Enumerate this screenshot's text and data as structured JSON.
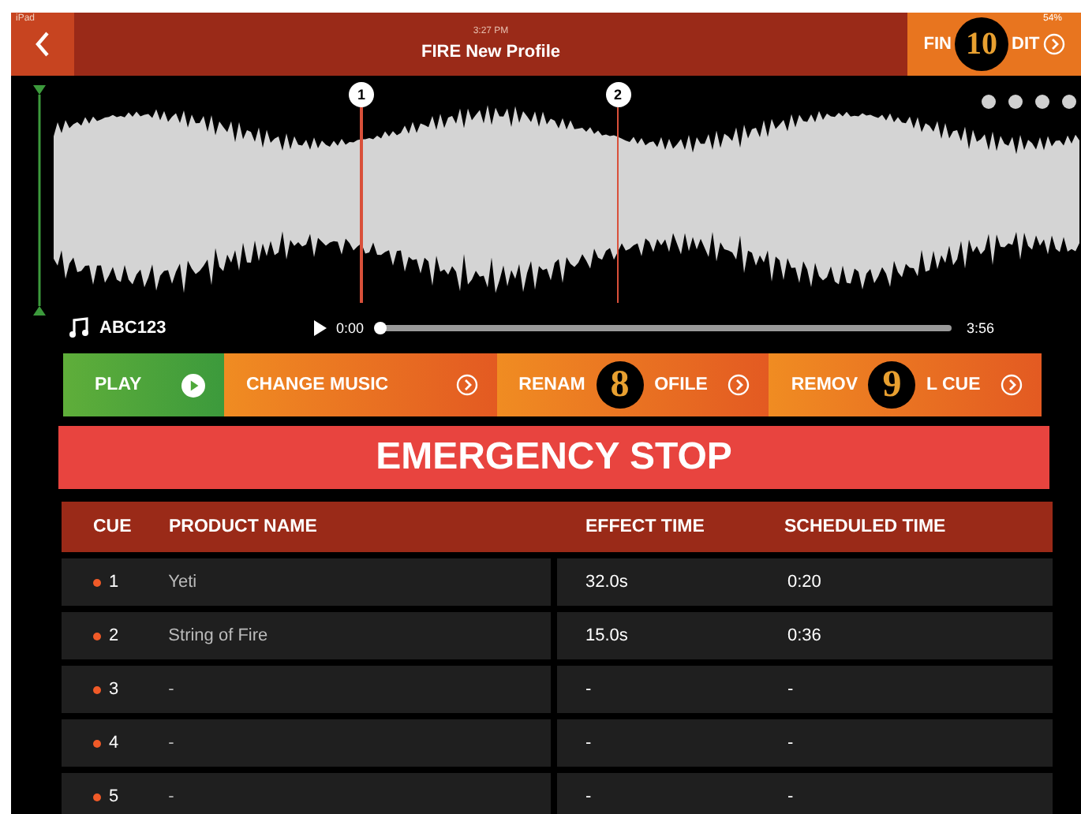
{
  "status_bar": {
    "device": "iPad",
    "time": "3:27 PM",
    "battery": "54%"
  },
  "nav": {
    "title": "FIRE New Profile",
    "finish": {
      "label_start": "FIN",
      "callout": "10",
      "label_end": "DIT"
    }
  },
  "waveform": {
    "markers": [
      {
        "label": "1"
      },
      {
        "label": "2"
      }
    ]
  },
  "track": {
    "name": "ABC123",
    "elapsed": "0:00",
    "duration": "3:56",
    "level": 0.0
  },
  "actions": [
    {
      "kind": "play",
      "label_start": "PLAY"
    },
    {
      "kind": "action",
      "label_start": "CHANGE MUSIC"
    },
    {
      "kind": "action",
      "label_start": "RENAM",
      "callout": "8",
      "label_end": "OFILE"
    },
    {
      "kind": "action",
      "label_start": "REMOV",
      "callout": "9",
      "label_end": "L CUE"
    }
  ],
  "emergency": "EMERGENCY STOP",
  "table": {
    "columns": [
      "CUE",
      "PRODUCT NAME",
      "EFFECT TIME",
      "SCHEDULED TIME"
    ],
    "rows": [
      {
        "cue": "1",
        "product": "Yeti",
        "effect": "32.0s",
        "scheduled": "0:20"
      },
      {
        "cue": "2",
        "product": "String of Fire",
        "effect": "15.0s",
        "scheduled": "0:36"
      },
      {
        "cue": "3",
        "product": "-",
        "effect": "-",
        "scheduled": "-"
      },
      {
        "cue": "4",
        "product": "-",
        "effect": "-",
        "scheduled": "-"
      },
      {
        "cue": "5",
        "product": "-",
        "effect": "-",
        "scheduled": "-"
      }
    ]
  }
}
